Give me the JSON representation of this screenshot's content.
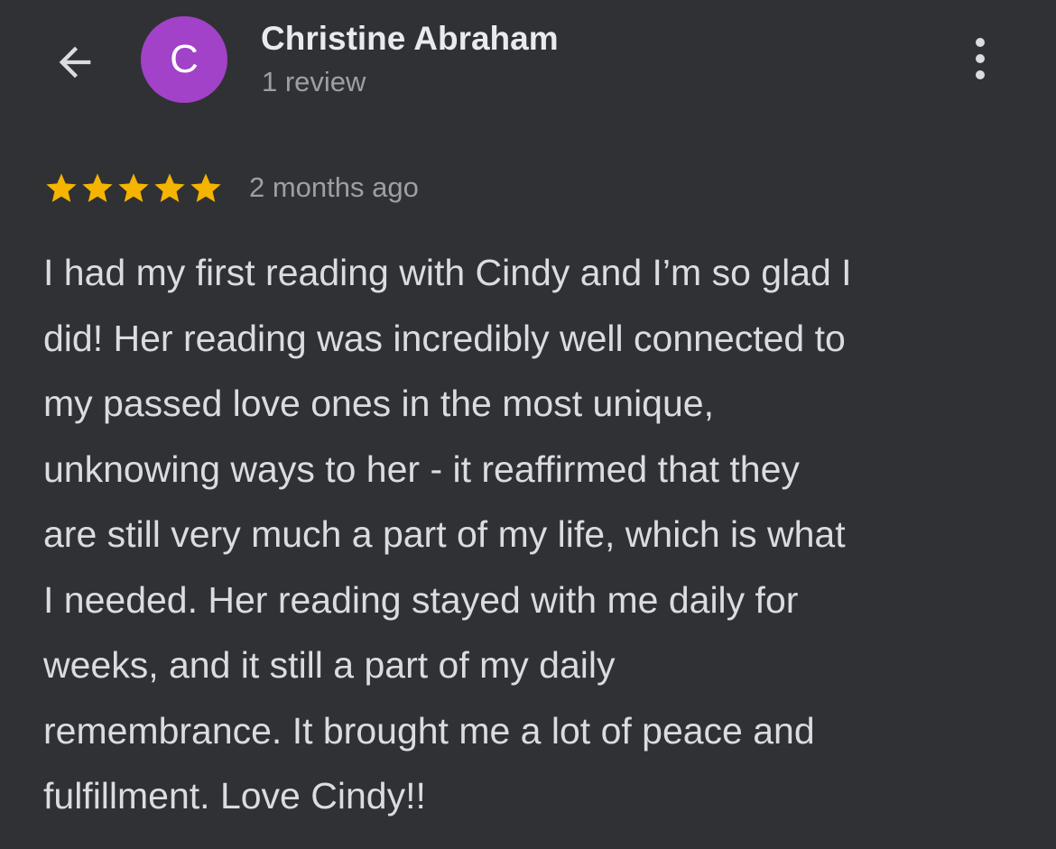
{
  "header": {
    "reviewer_name": "Christine Abraham",
    "avatar_initial": "C",
    "avatar_color": "#a142c8",
    "review_count": "1 review",
    "back_icon": "arrow-left-icon",
    "more_icon": "more-vert-icon"
  },
  "review": {
    "rating": 5,
    "rating_max": 5,
    "star_color": "#f4b400",
    "time_ago": "2 months ago",
    "text_lines": [
      "I had my first reading with Cindy and I’m so glad I",
      "did! Her reading was incredibly well connected to",
      "my passed love ones in the most unique,",
      "unknowing ways to her - it reaffirmed that they",
      "are still very much a part of my life, which is what",
      "I needed. Her reading stayed with me daily for",
      "weeks, and it still a part of my daily",
      "remembrance. It brought me a lot of peace and",
      "fulfillment. Love Cindy!!"
    ]
  },
  "theme": {
    "background": "#303134",
    "primary_text": "#e8eaed",
    "secondary_text": "#9aa0a6",
    "body_text": "#dadce0"
  }
}
